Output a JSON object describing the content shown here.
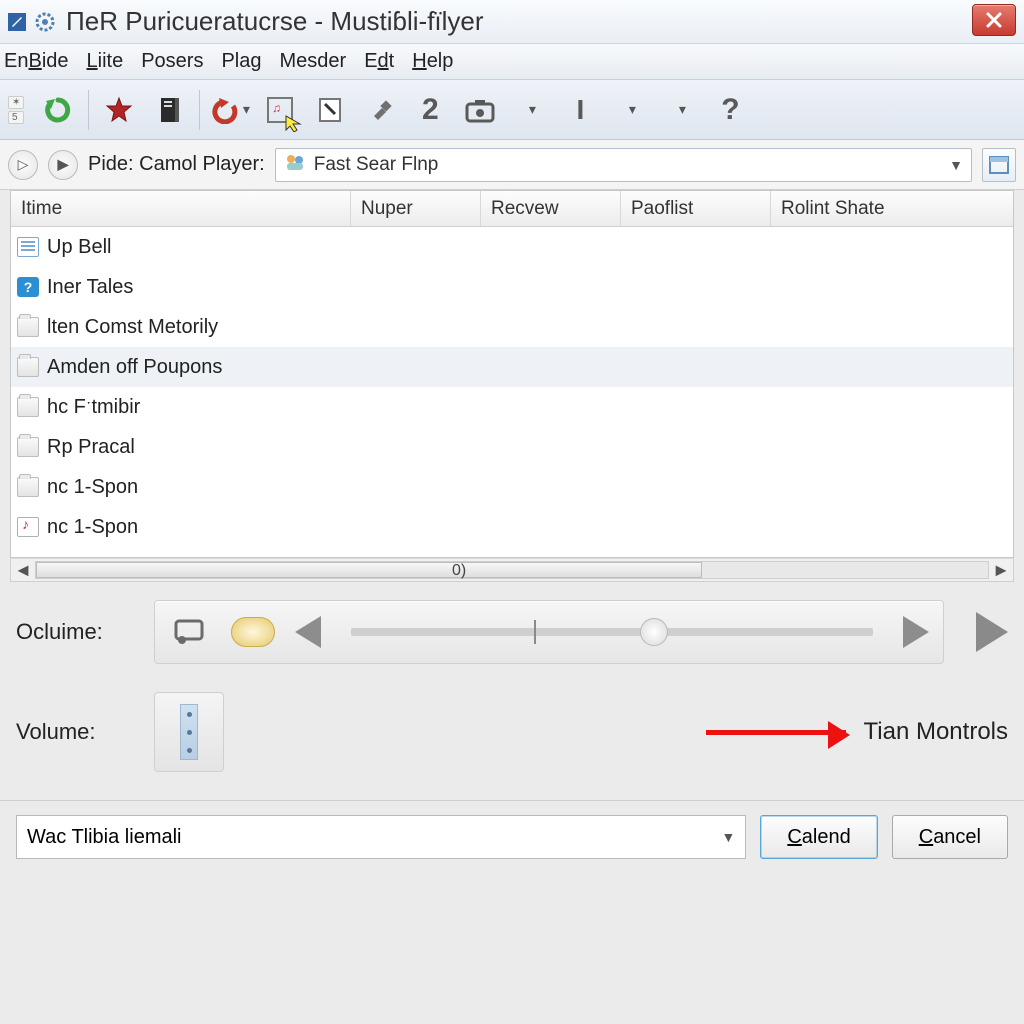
{
  "window": {
    "title": "ΠeR Puricueratucrse - Mustiɓli-fïlyer"
  },
  "menu": {
    "items": [
      "EnBide",
      "Liite",
      "Posers",
      "Plag",
      "Mesder",
      "Edt",
      "Help"
    ]
  },
  "address": {
    "label": "Pide: Camol Player:",
    "search_value": "Fast Sear Flnp"
  },
  "table": {
    "columns": [
      "Itime",
      "Nuper",
      "Recvew",
      "Paoflist",
      "Rolint Shate"
    ],
    "rows": [
      {
        "icon": "doc",
        "label": "Up Bell"
      },
      {
        "icon": "q",
        "label": "Iner Tales"
      },
      {
        "icon": "folder",
        "label": "lten Comst Metorily"
      },
      {
        "icon": "folder",
        "label": "Amden off Poupons",
        "selected": true
      },
      {
        "icon": "folder",
        "label": "hc Fˑtmibir"
      },
      {
        "icon": "folder",
        "label": "Rp Pracal"
      },
      {
        "icon": "folder",
        "label": "nc 1-Spon"
      },
      {
        "icon": "music",
        "label": "nc 1-Spon"
      }
    ],
    "scroll_label": "0)"
  },
  "controls": {
    "ocluime_label": "Ocluime:",
    "volume_label": "Volume:",
    "annotation": "Tian Montrols"
  },
  "bottom": {
    "combo_value": "Wac Tlibia liemali",
    "primary": "Calend",
    "cancel": "Cancel"
  }
}
